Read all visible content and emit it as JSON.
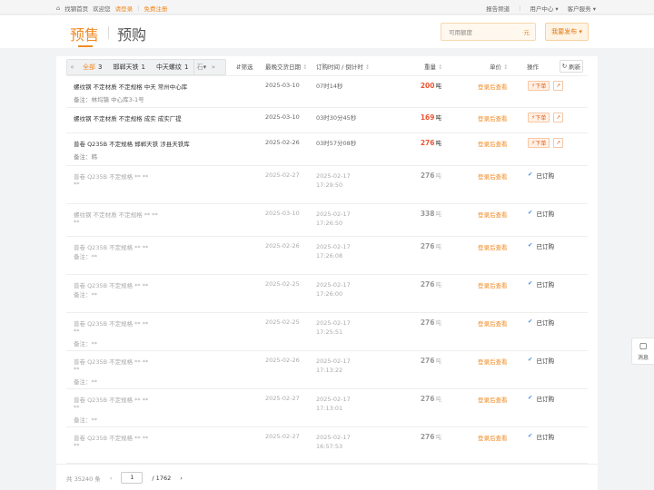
{
  "topbar": {
    "home": "找钢首页",
    "welcome": "欢迎您",
    "login": "请登录",
    "register": "免费注册",
    "report_channel": "报告频道",
    "user_center": "用户中心",
    "customer_service": "客户服务"
  },
  "header": {
    "tab_presale": "预售",
    "tab_preorder": "预购",
    "quota_placeholder": "可用额度",
    "quota_unit": "元",
    "publish": "我要发布"
  },
  "filters": [
    {
      "label": "全部",
      "count": "3",
      "active": true
    },
    {
      "label": "邯郸天铁",
      "count": "1",
      "active": false
    },
    {
      "label": "中天螺纹",
      "count": "1",
      "active": false
    }
  ],
  "filter_truncated": "石",
  "columns": {
    "filter": "筛选",
    "latest_date": "最晚交货日期",
    "order_time": "订购时间 / 倒计时",
    "weight": "重量",
    "price": "单价",
    "ops": "操作",
    "refresh": "刷新"
  },
  "rows": [
    {
      "product": "螺纹钢 不定材质 不定规格 中天 常州中心库",
      "note": "备注：林坞镇 中心库3-1号",
      "date": "2025-03-10",
      "time": "07时14秒",
      "time2": "",
      "weight": "200",
      "unit": "吨",
      "price": "登录后查看",
      "status": "order"
    },
    {
      "product": "螺纹钢 不定材质 不定规格 成实 成实厂提",
      "note": "",
      "date": "2025-03-10",
      "time": "03时30分45秒",
      "time2": "",
      "weight": "169",
      "unit": "吨",
      "price": "登录后查看",
      "status": "order"
    },
    {
      "product": "普卷 Q235B 不定规格 邯郸天铁 涉县天铁库",
      "note": "备注：韩",
      "date": "2025-02-26",
      "time": "03时57分08秒",
      "time2": "",
      "weight": "276",
      "unit": "吨",
      "price": "登录后查看",
      "status": "order"
    },
    {
      "product": "普卷 Q235B 不定规格 ** **",
      "note": "**",
      "date": "2025-02-27",
      "time": "2025-02-17",
      "time2": "17:29:50",
      "weight": "276",
      "unit": "吨",
      "price": "登录后查看",
      "status": "done"
    },
    {
      "product": "螺纹钢 不定材质 不定规格 ** **",
      "note": "**",
      "date": "2025-03-10",
      "time": "2025-02-17",
      "time2": "17:26:50",
      "weight": "338",
      "unit": "吨",
      "price": "登录后查看",
      "status": "done"
    },
    {
      "product": "普卷 Q235B 不定规格 ** **",
      "note": "备注：**",
      "date": "2025-02-26",
      "time": "2025-02-17",
      "time2": "17:26:08",
      "weight": "276",
      "unit": "吨",
      "price": "登录后查看",
      "status": "done"
    },
    {
      "product": "普卷 Q235B 不定规格 ** **",
      "note": "备注：**",
      "date": "2025-02-25",
      "time": "2025-02-17",
      "time2": "17:26:00",
      "weight": "276",
      "unit": "吨",
      "price": "登录后查看",
      "status": "done"
    },
    {
      "product": "普卷 Q235B 不定规格 ** **",
      "note": "**",
      "note2": "备注：**",
      "date": "2025-02-25",
      "time": "2025-02-17",
      "time2": "17:25:51",
      "weight": "276",
      "unit": "吨",
      "price": "登录后查看",
      "status": "done"
    },
    {
      "product": "普卷 Q235B 不定规格 ** **",
      "note": "**",
      "note2": "备注：**",
      "date": "2025-02-26",
      "time": "2025-02-17",
      "time2": "17:13:22",
      "weight": "276",
      "unit": "吨",
      "price": "登录后查看",
      "status": "done"
    },
    {
      "product": "普卷 Q235B 不定规格 ** **",
      "note": "**",
      "note2": "备注：**",
      "date": "2025-02-27",
      "time": "2025-02-17",
      "time2": "17:13:01",
      "weight": "276",
      "unit": "吨",
      "price": "登录后查看",
      "status": "done"
    },
    {
      "product": "普卷 Q235B 不定规格 ** **",
      "note": "**",
      "date": "2025-02-27",
      "time": "2025-02-17",
      "time2": "16:57:53",
      "weight": "276",
      "unit": "吨",
      "price": "登录后查看",
      "status": "done"
    }
  ],
  "labels": {
    "order": "下单",
    "ordered": "已订购"
  },
  "pager": {
    "total": "共 35240 条",
    "current": "1",
    "pages": "/ 1762"
  },
  "float_msg": "消息",
  "colors": {
    "accent": "#f08a24",
    "weight": "#e53e1f"
  }
}
